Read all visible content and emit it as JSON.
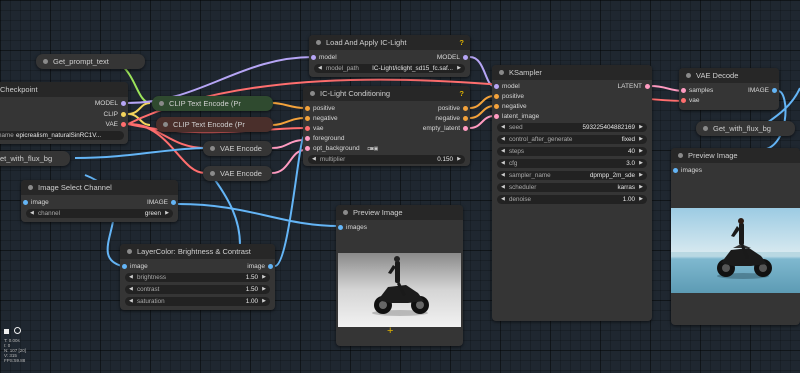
{
  "colors": {
    "canvas": "#1f2730",
    "node_body": "#353535",
    "node_title": "#272727",
    "clip_node": "#2f4a2f",
    "clip_neg_node": "#4a2f2b",
    "wire_clip": "#f3d45c",
    "wire_model": "#b6a5f5",
    "wire_conditioning": "#f3a23b",
    "wire_latent": "#ff9bc1",
    "wire_vae": "#ff6e6e",
    "wire_image": "#64b5f6",
    "wire_string": "#9be35a"
  },
  "nodes": {
    "checkpoint": {
      "title": "Checkpoint",
      "outputs": [
        "MODEL",
        "CLIP",
        "VAE"
      ],
      "ckpt_label": "name",
      "ckpt_value": "epicrealism_naturalSinRC1V..."
    },
    "get_prompt": {
      "title": "Get_prompt_text"
    },
    "get_flux_left": {
      "title": "et_with_flux_bg"
    },
    "clip_pos": {
      "title": "CLIP Text Encode (Pr"
    },
    "clip_neg": {
      "title": "CLIP Text Encode (Pr"
    },
    "vae_encode_1": {
      "title": "VAE Encode"
    },
    "vae_encode_2": {
      "title": "VAE Encode"
    },
    "load_iclight": {
      "title": "Load And Apply IC-Light",
      "help": "?",
      "input_model": "model",
      "output_model": "MODEL",
      "model_path_label": "model_path",
      "model_path_value": "IC-Light/iclight_sd15_fc.saf..."
    },
    "iclight_cond": {
      "title": "IC-Light Conditioning",
      "help": "?",
      "inputs": [
        "positive",
        "negative",
        "vae",
        "foreground",
        "opt_background"
      ],
      "outputs": [
        "positive",
        "negative",
        "empty_latent"
      ],
      "multiplier_label": "multiplier",
      "multiplier_value": "0.150"
    },
    "ksampler": {
      "title": "KSampler",
      "inputs": [
        "model",
        "positive",
        "negative",
        "latent_image"
      ],
      "output": "LATENT",
      "widgets": [
        {
          "label": "seed",
          "value": "593225404882169"
        },
        {
          "label": "control_after_generate",
          "value": "fixed"
        },
        {
          "label": "steps",
          "value": "40"
        },
        {
          "label": "cfg",
          "value": "3.0"
        },
        {
          "label": "sampler_name",
          "value": "dpmpp_2m_sde"
        },
        {
          "label": "scheduler",
          "value": "karras"
        },
        {
          "label": "denoise",
          "value": "1.00"
        }
      ]
    },
    "vae_decode": {
      "title": "VAE Decode",
      "inputs": [
        "samples",
        "vae"
      ],
      "output": "IMAGE"
    },
    "get_flux_right": {
      "title": "Get_with_flux_bg"
    },
    "preview_right": {
      "title": "Preview Image",
      "input": "images"
    },
    "image_select": {
      "title": "Image Select Channel",
      "input": "image",
      "output": "IMAGE",
      "channel_label": "channel",
      "channel_value": "green"
    },
    "layercolor": {
      "title": "LayerColor: Brightness & Contrast",
      "input": "image",
      "output": "image",
      "widgets": [
        {
          "label": "brightness",
          "value": "1.50"
        },
        {
          "label": "contrast",
          "value": "1.50"
        },
        {
          "label": "saturation",
          "value": "1.00"
        }
      ]
    },
    "preview_mid": {
      "title": "Preview Image",
      "input": "images"
    }
  },
  "stats": {
    "lines": [
      "T: 0.00s",
      "I: 0",
      "N: 107 [20]",
      "V: 315",
      "FPS:59.88"
    ]
  }
}
